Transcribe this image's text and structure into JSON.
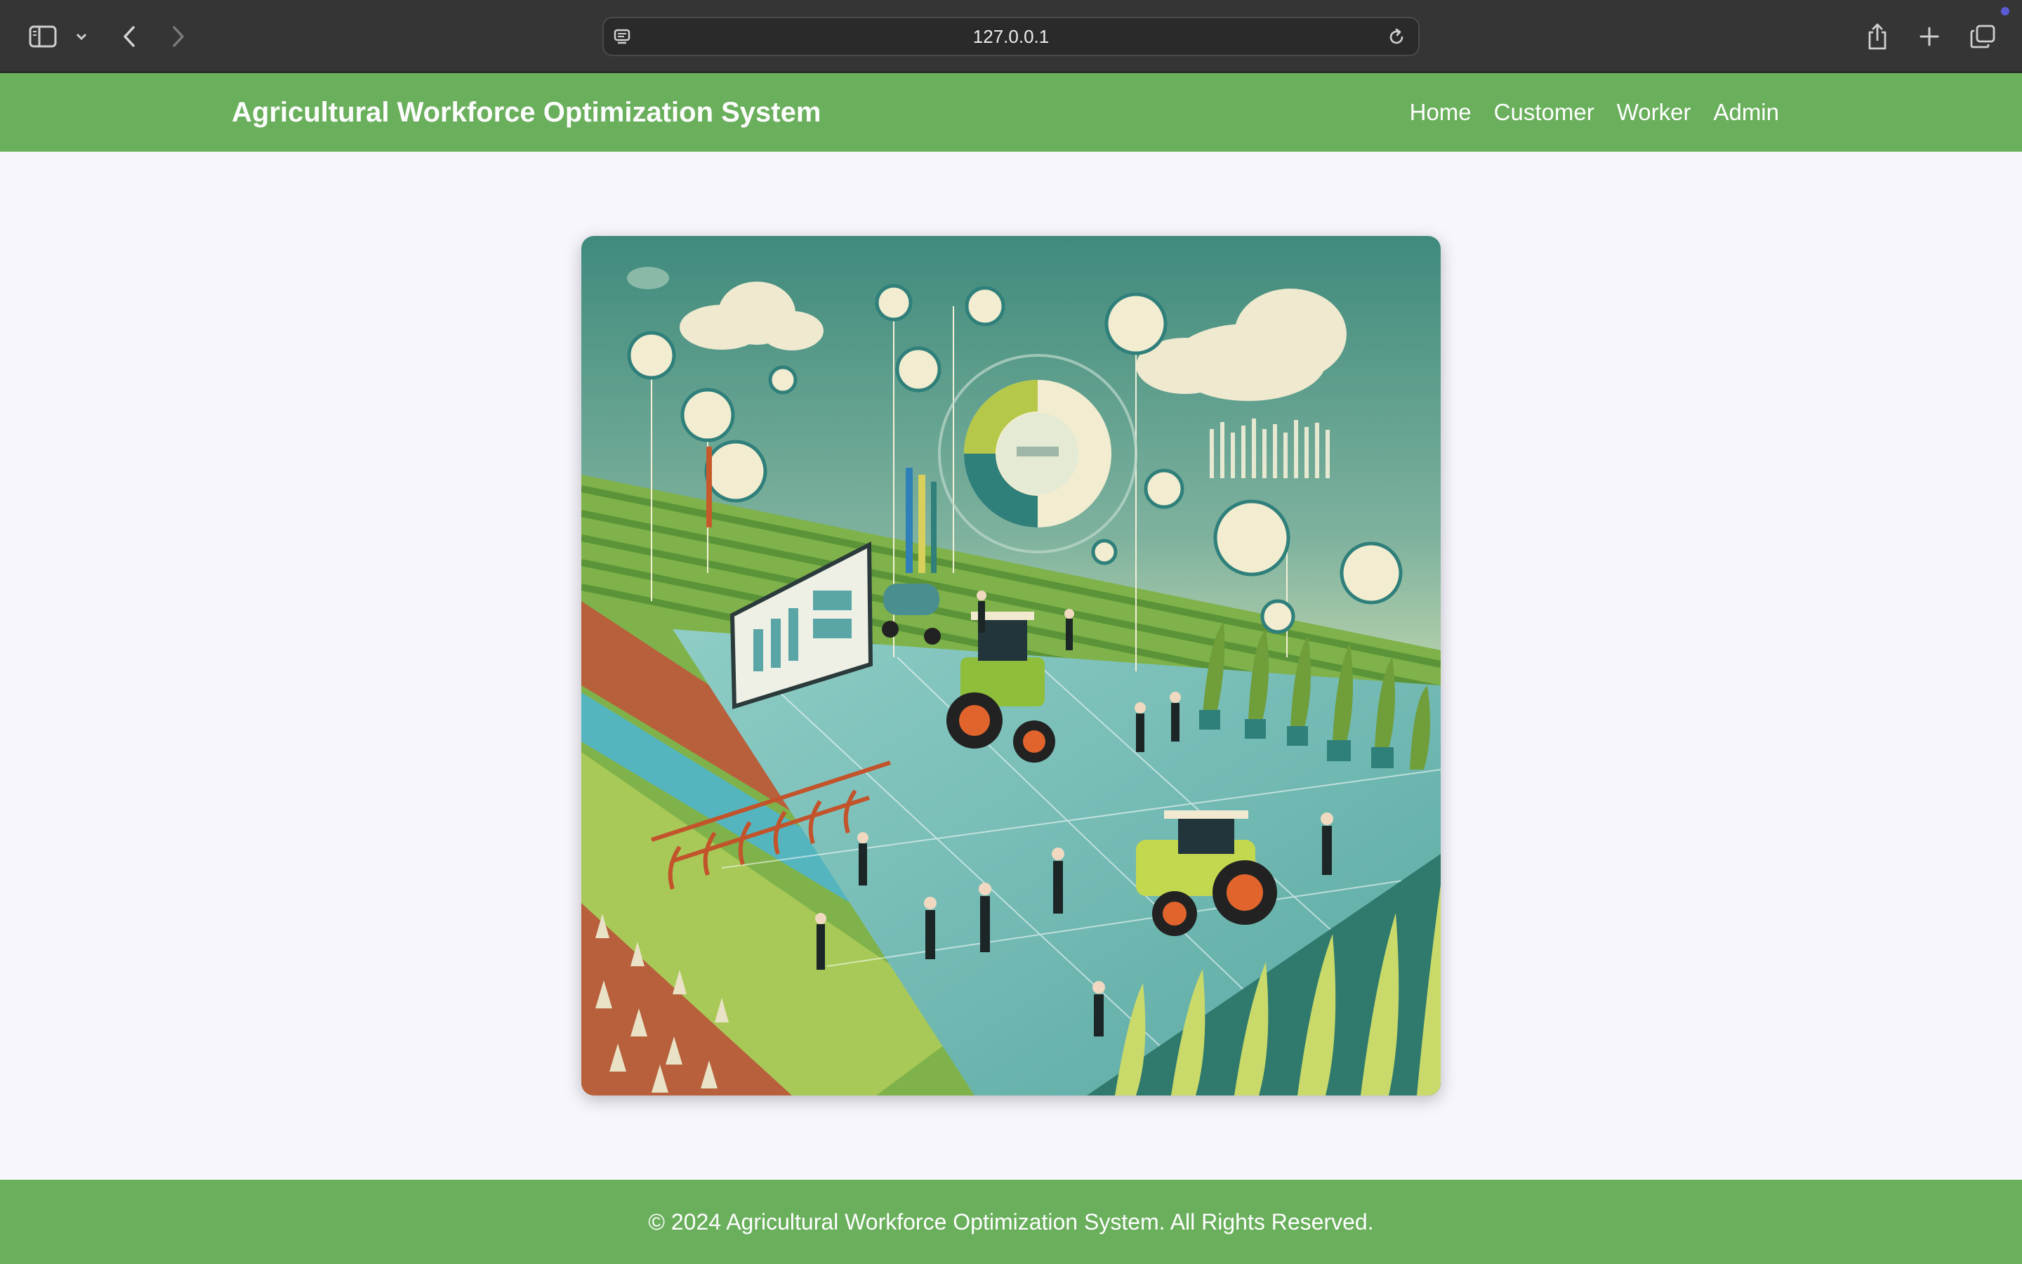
{
  "browser": {
    "url": "127.0.0.1",
    "icons": [
      "sidebar-icon",
      "chevron-down-icon",
      "back-icon",
      "forward-icon",
      "site-settings-icon",
      "reload-icon",
      "share-icon",
      "new-tab-icon",
      "tabs-overview-icon"
    ]
  },
  "header": {
    "brand": "Agricultural Workforce Optimization System",
    "nav": [
      {
        "label": "Home"
      },
      {
        "label": "Customer"
      },
      {
        "label": "Worker"
      },
      {
        "label": "Admin"
      }
    ]
  },
  "footer": {
    "text": "© 2024 Agricultural Workforce Optimization System. All Rights Reserved."
  },
  "colors": {
    "brand_green": "#6aaf5c",
    "page_background": "#f6f6fc",
    "chrome_background": "#353535"
  }
}
